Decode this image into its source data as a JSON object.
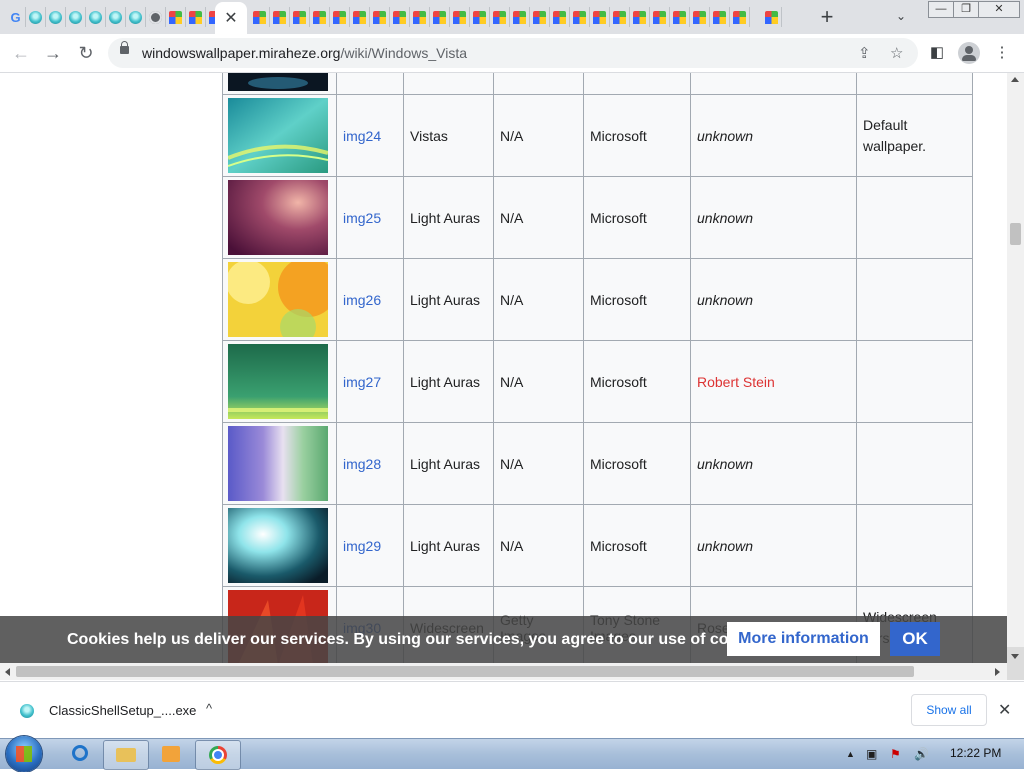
{
  "browser": {
    "active_tab_close": "✕",
    "new_tab": "+",
    "tab_list": "⌄",
    "window_controls": {
      "minimize": "—",
      "maximize": "❐",
      "close": "✕"
    },
    "nav": {
      "back": "←",
      "forward": "→",
      "reload": "↻"
    },
    "url_host": "windowswallpaper.miraheze.org",
    "url_path": "/wiki/Windows_Vista",
    "toolbar_icons": [
      "share-icon",
      "star-icon",
      "side-panel-icon",
      "profile-icon",
      "menu-icon"
    ],
    "menu": "⋮"
  },
  "table": {
    "rows": [
      {
        "id": "img24",
        "name": "Vistas",
        "na": "N/A",
        "source": "Microsoft",
        "author": "unknown",
        "author_style": "italic",
        "desc": "Default wallpaper."
      },
      {
        "id": "img25",
        "name": "Light Auras",
        "na": "N/A",
        "source": "Microsoft",
        "author": "unknown",
        "author_style": "italic",
        "desc": ""
      },
      {
        "id": "img26",
        "name": "Light Auras",
        "na": "N/A",
        "source": "Microsoft",
        "author": "unknown",
        "author_style": "italic",
        "desc": ""
      },
      {
        "id": "img27",
        "name": "Light Auras",
        "na": "N/A",
        "source": "Microsoft",
        "author": "Robert Stein",
        "author_style": "redlink",
        "desc": ""
      },
      {
        "id": "img28",
        "name": "Light Auras",
        "na": "N/A",
        "source": "Microsoft",
        "author": "unknown",
        "author_style": "italic",
        "desc": ""
      },
      {
        "id": "img29",
        "name": "Light Auras",
        "na": "N/A",
        "source": "Microsoft",
        "author": "unknown",
        "author_style": "italic",
        "desc": ""
      },
      {
        "id": "img30",
        "name": "Widescreen",
        "na": "Getty Images",
        "source": "Tony Stone Images",
        "author": "Rosemary Calvert",
        "author_style": "plain",
        "desc": "Widescreen version of"
      }
    ]
  },
  "cookie_banner": {
    "text": "Cookies help us deliver our services. By using our services, you agree to our use of cookies.",
    "more_label": "More information",
    "ok_label": "OK"
  },
  "downloads": {
    "file_name": "ClassicShellSetup_....exe",
    "caret": "^",
    "show_all": "Show all",
    "close": "✕"
  },
  "taskbar": {
    "clock": "12:22 PM",
    "tray_show_hidden": "▲",
    "tray_volume": "🔊"
  }
}
